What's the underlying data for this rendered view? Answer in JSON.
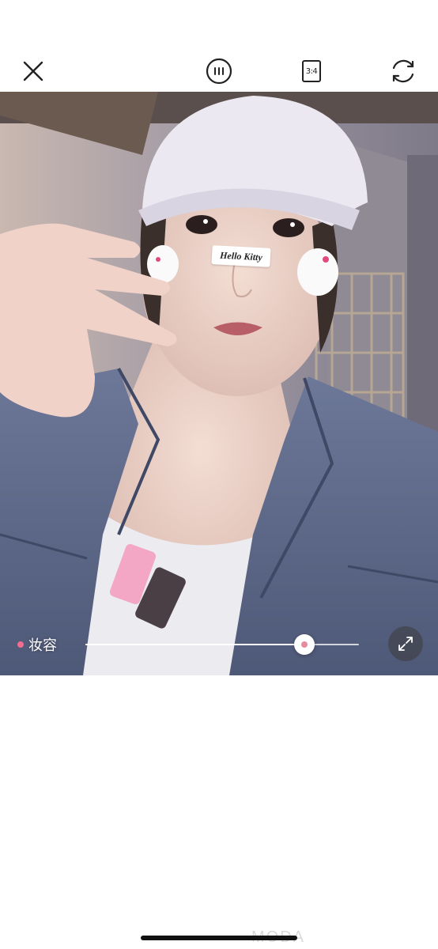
{
  "toolbar": {
    "close_icon": "close-icon",
    "grid_icon": "grid-icon",
    "ratio_label": "3:4",
    "flip_icon": "flip-camera-icon"
  },
  "sticker": {
    "text": "Hello Kitty"
  },
  "makeup": {
    "label": "妆容",
    "dot_color": "#f26d8f",
    "intensity": 0.8
  },
  "expand_icon": "expand-icon",
  "watermark": "MODA",
  "colors": {
    "background": "#ffffff",
    "accent": "#f26d8f"
  }
}
